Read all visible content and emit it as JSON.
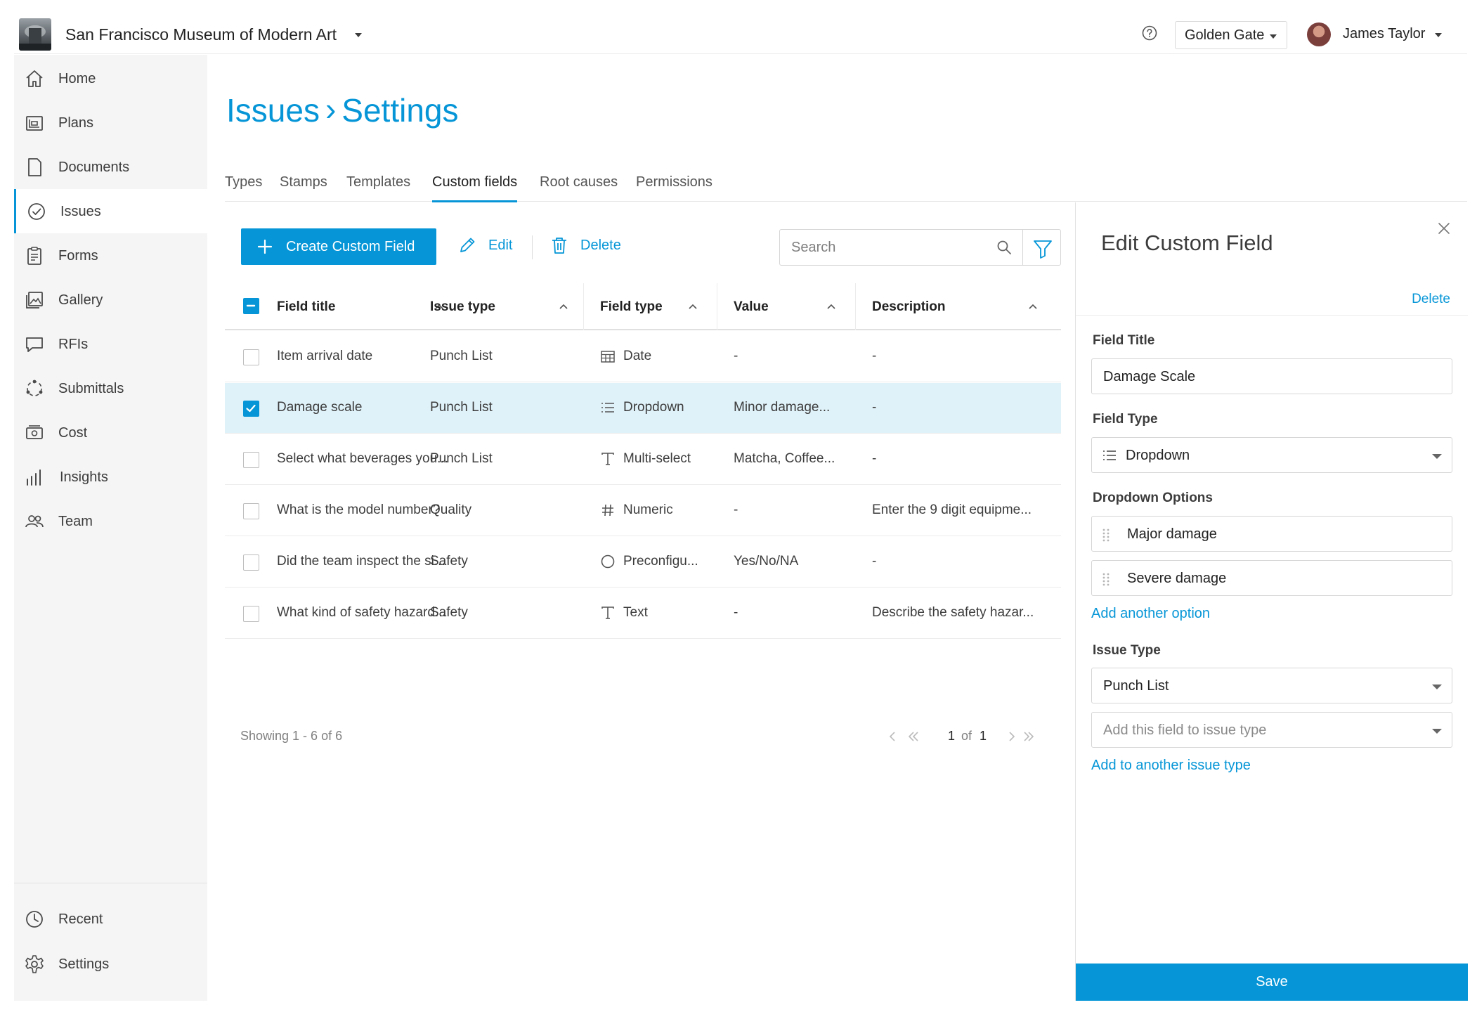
{
  "header": {
    "project_name": "San Francisco Museum of Modern Art",
    "company": "Golden Gate",
    "user_name": "James Taylor"
  },
  "sidebar": {
    "items": [
      {
        "label": "Home",
        "icon": "home-icon"
      },
      {
        "label": "Plans",
        "icon": "plans-icon"
      },
      {
        "label": "Documents",
        "icon": "document-icon"
      },
      {
        "label": "Issues",
        "icon": "check-circle-icon",
        "active": true
      },
      {
        "label": "Forms",
        "icon": "clipboard-icon"
      },
      {
        "label": "Gallery",
        "icon": "gallery-icon"
      },
      {
        "label": "RFIs",
        "icon": "chat-bubble-icon"
      },
      {
        "label": "Submittals",
        "icon": "submittals-icon"
      },
      {
        "label": "Cost",
        "icon": "cost-icon"
      },
      {
        "label": "Insights",
        "icon": "bar-chart-icon"
      },
      {
        "label": "Team",
        "icon": "team-icon"
      }
    ],
    "bottom": [
      {
        "label": "Recent",
        "icon": "clock-icon"
      },
      {
        "label": "Settings",
        "icon": "gear-icon"
      }
    ]
  },
  "page": {
    "title_part1": "Issues",
    "title_sep": "›",
    "title_part2": "Settings"
  },
  "tabs": [
    "Types",
    "Stamps",
    "Templates",
    "Custom fields",
    "Root causes",
    "Permissions"
  ],
  "active_tab": "Custom fields",
  "toolbar": {
    "create_label": "Create Custom Field",
    "edit_label": "Edit",
    "delete_label": "Delete",
    "search_placeholder": "Search"
  },
  "table": {
    "columns": [
      "Field title",
      "Issue type",
      "Field type",
      "Value",
      "Description"
    ],
    "rows": [
      {
        "title": "Item arrival date",
        "issue_type": "Punch List",
        "field_type": "Date",
        "field_icon": "calendar-icon",
        "value": "-",
        "description": "-",
        "selected": false
      },
      {
        "title": "Damage scale",
        "issue_type": "Punch List",
        "field_type": "Dropdown",
        "field_icon": "list-icon",
        "value": "Minor damage...",
        "description": "-",
        "selected": true
      },
      {
        "title": "Select what beverages you...",
        "issue_type": "Punch List",
        "field_type": "Multi-select",
        "field_icon": "text-icon",
        "value": "Matcha, Coffee...",
        "description": "-",
        "selected": false
      },
      {
        "title": "What is the model number?",
        "issue_type": "Quality",
        "field_type": "Numeric",
        "field_icon": "hash-icon",
        "value": "-",
        "description": "Enter the 9 digit equipme...",
        "selected": false
      },
      {
        "title": "Did the team inspect the si...",
        "issue_type": "Safety",
        "field_type": "Preconfigu...",
        "field_icon": "circle-icon",
        "value": "Yes/No/NA",
        "description": "-",
        "selected": false
      },
      {
        "title": "What kind of safety hazard...",
        "issue_type": "Safety",
        "field_type": "Text",
        "field_icon": "text-icon",
        "value": "-",
        "description": "Describe the safety hazar...",
        "selected": false
      }
    ],
    "footer": "Showing 1 - 6 of 6",
    "page_current": "1",
    "page_of": "of",
    "page_total": "1"
  },
  "panel": {
    "title": "Edit Custom Field",
    "delete_label": "Delete",
    "field_title_label": "Field Title",
    "field_title_value": "Damage Scale",
    "field_type_label": "Field Type",
    "field_type_value": "Dropdown",
    "options_label": "Dropdown Options",
    "options": [
      "Major damage",
      "Severe damage"
    ],
    "add_option": "Add another option",
    "issue_type_label": "Issue Type",
    "issue_type_value": "Punch List",
    "issue_type_placeholder": "Add this field to issue type",
    "add_issue_type": "Add to another issue type",
    "save_label": "Save"
  },
  "colors": {
    "accent": "#0696d7",
    "selected_row": "#e0f2f9",
    "sidebar_bg": "#f5f5f5"
  }
}
